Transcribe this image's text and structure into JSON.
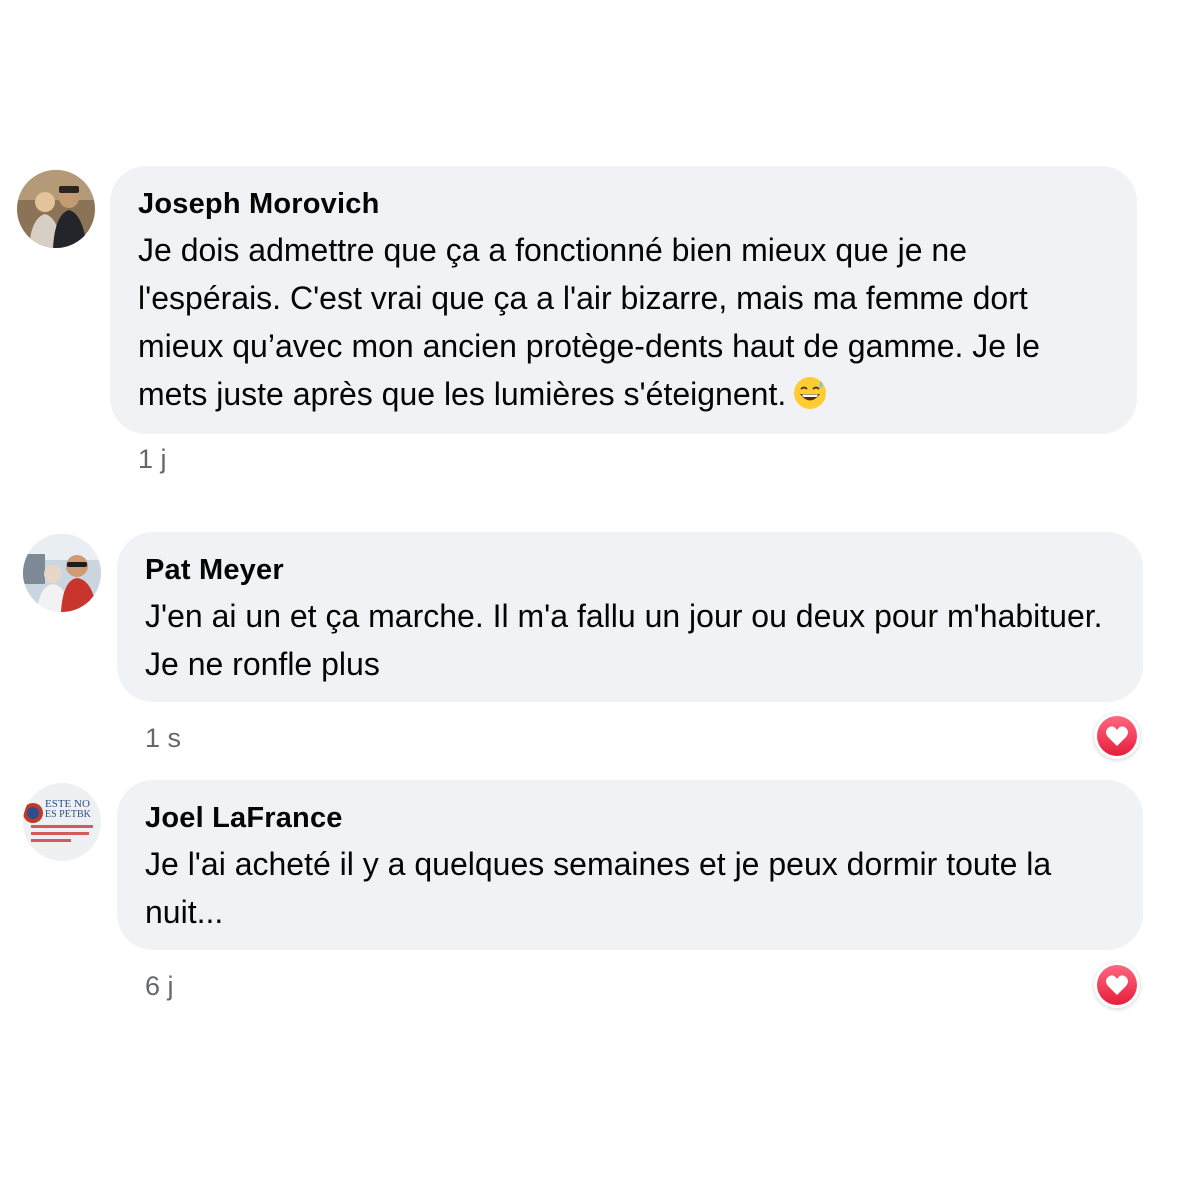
{
  "comments": [
    {
      "author": "Joseph Morovich",
      "text": "Je dois admettre que ça a fonctionné bien mieux que je ne l'espérais. C'est vrai que ça a l'air bizarre, mais ma femme dort mieux qu’avec mon ancien protège-dents haut de gamme. Je le mets juste après que les lumières s'éteignent.",
      "emoji": "grinning-sweat-emoji",
      "time": "1 j",
      "reaction": null
    },
    {
      "author": "Pat Meyer",
      "text": "J'en ai un et ça marche. Il m'a fallu un jour ou deux pour m'habituer. Je ne ronfle plus",
      "time": "1 s",
      "reaction": "heart-icon"
    },
    {
      "author": "Joel LaFrance",
      "text": "Je l'ai acheté il y a quelques semaines et je peux dormir toute la nuit...",
      "time": "6 j",
      "reaction": "heart-icon"
    }
  ],
  "avatar_3_logo_text": [
    "ESTE NO",
    "ES PETBK"
  ],
  "colors": {
    "bubble": "#f0f2f5",
    "text": "#050505",
    "secondary": "#65676b",
    "heart_gradient_top": "#ff6680",
    "heart_gradient_bottom": "#e61e3c"
  }
}
